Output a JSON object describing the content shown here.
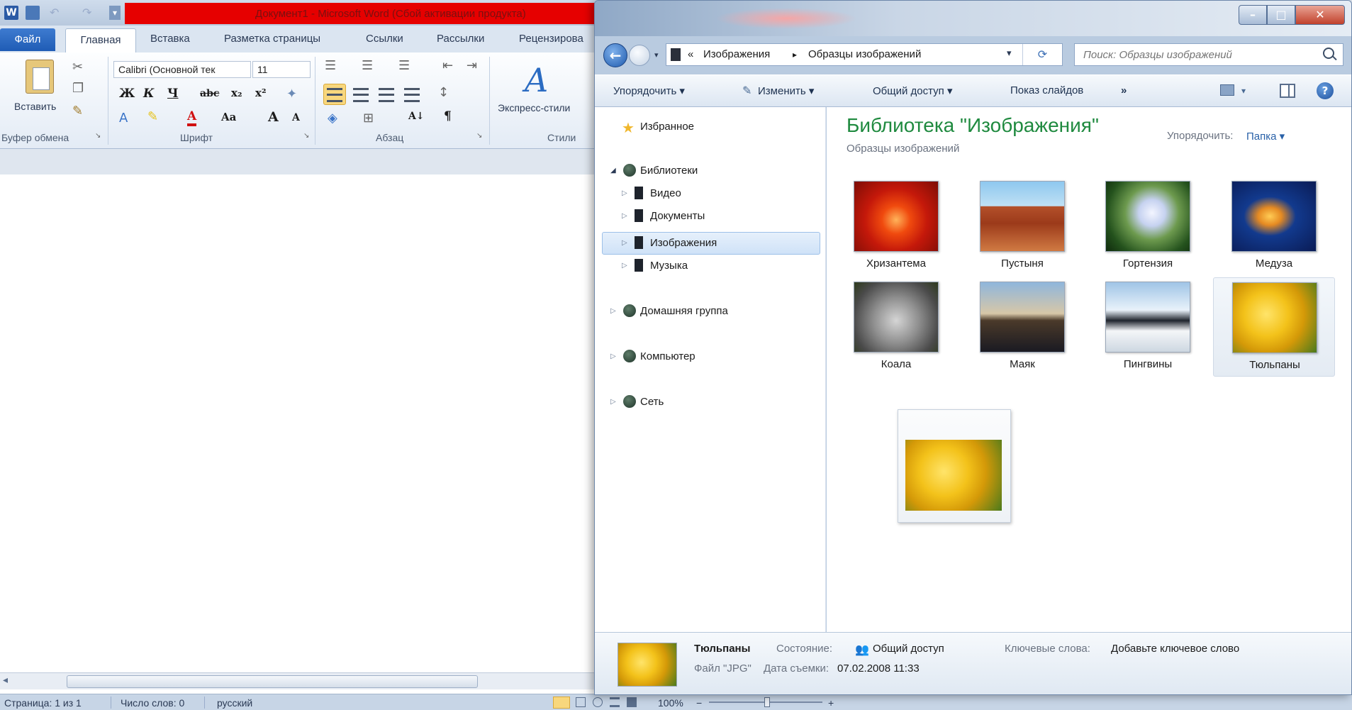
{
  "word": {
    "title": "Документ1 - Microsoft Word (Сбой активации продукта)",
    "qat_logo": "W",
    "tabs": {
      "file": "Файл",
      "home": "Главная",
      "insert": "Вставка",
      "layout": "Разметка страницы",
      "references": "Ссылки",
      "mailings": "Рассылки",
      "review": "Рецензирова"
    },
    "ribbon": {
      "paste_label": "Вставить",
      "clipboard_label": "Буфер обмена",
      "font_name": "Calibri (Основной тек",
      "font_size": "11",
      "font_label": "Шрифт",
      "bold": "Ж",
      "italic": "К",
      "underline": "Ч",
      "strike": "abc",
      "sub": "x₂",
      "sup": "x²",
      "case": "Aa",
      "grow": "A",
      "shrink": "A",
      "paragraph_label": "Абзац",
      "pilcrow": "¶",
      "sort": "A↓",
      "styles_label": "Экспресс-стили",
      "styles_group_label": "Стили"
    },
    "status": {
      "page": "Страница: 1 из 1",
      "words": "Число слов: 0",
      "language": "русский",
      "zoom": "100%",
      "zoom_minus": "−",
      "zoom_plus": "+"
    }
  },
  "explorer": {
    "nav": {
      "back": "←",
      "crumb_prefix": "«",
      "crumb_1": "Изображения",
      "crumb_sep": "▸",
      "crumb_2": "Образцы изображений",
      "search_placeholder": "Поиск: Образцы изображений"
    },
    "caption": {
      "min": "–",
      "max": "□",
      "close": "✕"
    },
    "toolbar": {
      "organize": "Упорядочить ▾",
      "edit": "Изменить ▾",
      "share": "Общий доступ ▾",
      "slideshow": "Показ слайдов",
      "more": "»",
      "help": "?"
    },
    "nav_pane": {
      "favorites": "Избранное",
      "libraries": "Библиотеки",
      "video": "Видео",
      "documents": "Документы",
      "pictures": "Изображения",
      "music": "Музыка",
      "homegroup": "Домашняя группа",
      "computer": "Компьютер",
      "network": "Сеть"
    },
    "content": {
      "title": "Библиотека \"Изображения\"",
      "subtitle": "Образцы изображений",
      "arrange_label": "Упорядочить:",
      "arrange_value": "Папка ▾",
      "items": [
        {
          "name": "Хризантема"
        },
        {
          "name": "Пустыня"
        },
        {
          "name": "Гортензия"
        },
        {
          "name": "Медуза"
        },
        {
          "name": "Коала"
        },
        {
          "name": "Маяк"
        },
        {
          "name": "Пингвины"
        },
        {
          "name": "Тюльпаны"
        }
      ]
    },
    "details": {
      "filename": "Тюльпаны",
      "state_label": "Состояние:",
      "state_value": "Общий доступ",
      "keywords_label": "Ключевые слова:",
      "keywords_value": "Добавьте ключевое слово",
      "type": "Файл \"JPG\"",
      "date_label": "Дата съемки:",
      "date_value": "07.02.2008 11:33"
    }
  },
  "colors": {
    "word_title_red": "#e60000",
    "library_title_green": "#1f8a3f",
    "selection_blue": "#cfe2f8"
  }
}
